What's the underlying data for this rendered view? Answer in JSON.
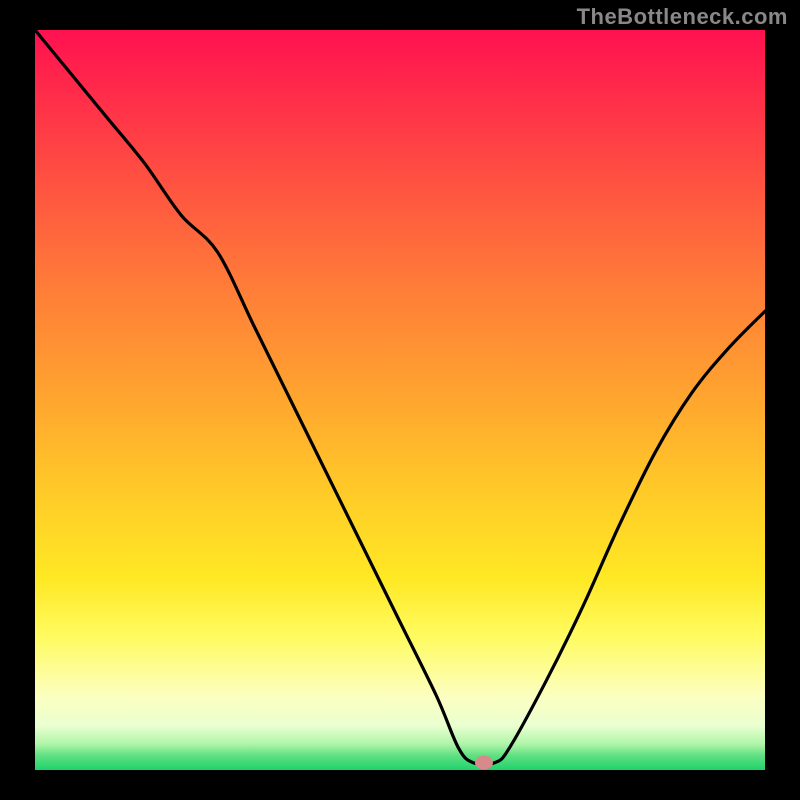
{
  "watermark": "TheBottleneck.com",
  "chart_data": {
    "type": "line",
    "title": "",
    "xlabel": "",
    "ylabel": "",
    "xlim": [
      0,
      100
    ],
    "ylim": [
      0,
      100
    ],
    "grid": false,
    "legend": false,
    "background": {
      "type": "vertical-gradient",
      "stops": [
        {
          "pct": 0,
          "color": "#ff1150"
        },
        {
          "pct": 22,
          "color": "#ff5640"
        },
        {
          "pct": 48,
          "color": "#ffa030"
        },
        {
          "pct": 74,
          "color": "#ffe824"
        },
        {
          "pct": 90,
          "color": "#fcffc0"
        },
        {
          "pct": 98,
          "color": "#62e084"
        },
        {
          "pct": 100,
          "color": "#1fd36b"
        }
      ]
    },
    "series": [
      {
        "name": "bottleneck-curve",
        "x": [
          0,
          5,
          10,
          15,
          20,
          25,
          30,
          35,
          40,
          45,
          50,
          55,
          58,
          60,
          63,
          65,
          70,
          75,
          80,
          85,
          90,
          95,
          100
        ],
        "y": [
          100,
          94,
          88,
          82,
          75,
          70,
          60,
          50,
          40,
          30,
          20,
          10,
          3,
          1,
          1,
          3,
          12,
          22,
          33,
          43,
          51,
          57,
          62
        ]
      }
    ],
    "marker": {
      "x": 61.5,
      "y": 1,
      "color": "#d88a8a"
    }
  }
}
